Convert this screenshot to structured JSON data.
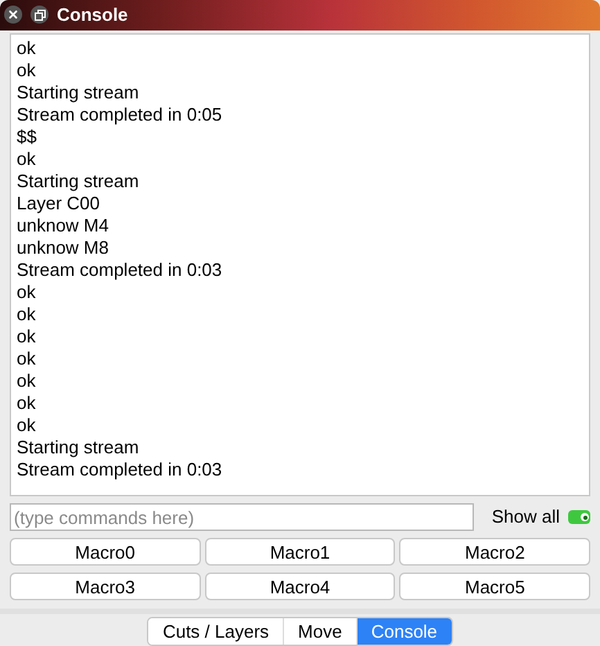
{
  "window": {
    "title": "Console"
  },
  "log": [
    "ok",
    "ok",
    "Starting stream",
    "Stream completed in 0:05",
    "$$",
    "ok",
    "Starting stream",
    "Layer C00",
    "unknow M4",
    "unknow M8",
    "Stream completed in 0:03",
    "ok",
    "ok",
    "ok",
    "ok",
    "ok",
    "ok",
    "ok",
    "Starting stream",
    "Stream completed in 0:03"
  ],
  "command": {
    "placeholder": "(type commands here)"
  },
  "show_all": {
    "label": "Show all",
    "on": true
  },
  "macros": [
    "Macro0",
    "Macro1",
    "Macro2",
    "Macro3",
    "Macro4",
    "Macro5"
  ],
  "tabs": [
    {
      "label": "Cuts / Layers",
      "selected": false
    },
    {
      "label": "Move",
      "selected": false
    },
    {
      "label": "Console",
      "selected": true
    }
  ]
}
